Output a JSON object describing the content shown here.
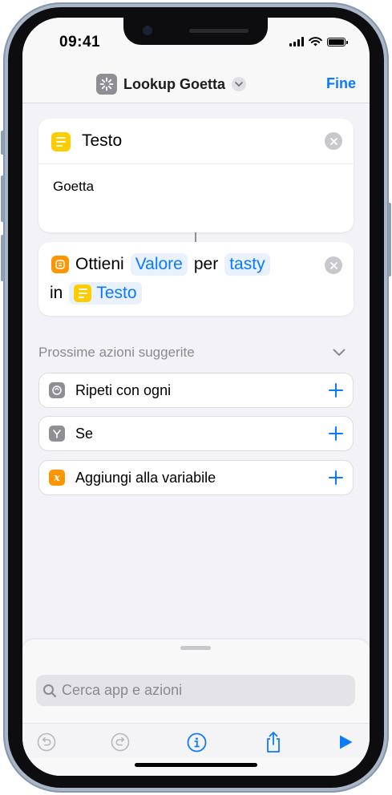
{
  "status_bar": {
    "time": "09:41"
  },
  "nav": {
    "title": "Lookup Goetta",
    "done_label": "Fine"
  },
  "text_action": {
    "title": "Testo",
    "content": "Goetta"
  },
  "dictionary_action": {
    "verb": "Ottieni",
    "value_token": "Valore",
    "preposition": "per",
    "key_token": "tasty",
    "in_word": "in",
    "source_token": "Testo"
  },
  "suggestions": {
    "heading": "Prossime azioni suggerite",
    "items": [
      {
        "label": "Ripeti con ogni",
        "icon": "repeat-icon",
        "color": "#8e8e93"
      },
      {
        "label": "Se",
        "icon": "branch-icon",
        "color": "#8e8e93"
      },
      {
        "label": "Aggiungi alla variabile",
        "icon": "variable-icon",
        "glyph": "x",
        "color": "#ff9500"
      }
    ]
  },
  "search": {
    "placeholder": "Cerca app e azioni"
  },
  "toolbar": {
    "items": [
      "undo-icon",
      "redo-icon",
      "info-icon",
      "share-icon",
      "play-icon"
    ]
  },
  "colors": {
    "accent": "#0a7aff",
    "text_action": "#ffcc00",
    "dictionary_action": "#ff9500"
  }
}
